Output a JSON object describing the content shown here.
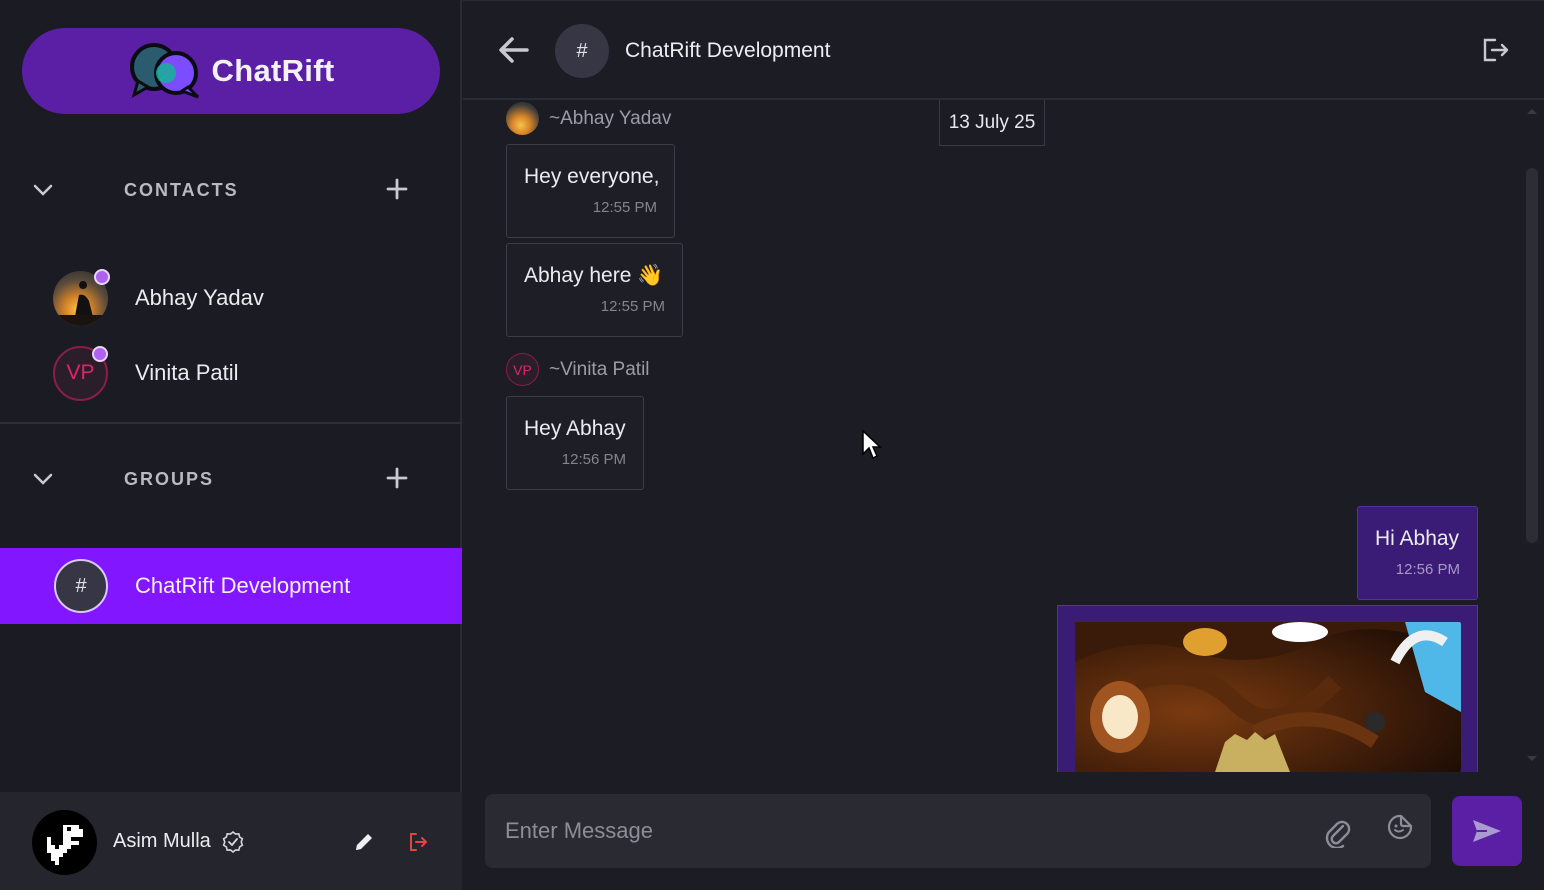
{
  "app": {
    "name": "ChatRift"
  },
  "sidebar": {
    "contacts_title": "CONTACTS",
    "groups_title": "GROUPS",
    "contacts": [
      {
        "name": "Abhay Yadav",
        "initials": "",
        "online": true
      },
      {
        "name": "Vinita Patil",
        "initials": "VP",
        "online": true
      }
    ],
    "groups": [
      {
        "name": "ChatRift Development",
        "icon": "#",
        "active": true
      }
    ],
    "user": {
      "name": "Asim Mulla",
      "verified": true
    }
  },
  "channel": {
    "name": "ChatRift Development",
    "icon": "#"
  },
  "messages": {
    "date_chip": "13 July 25",
    "groups": [
      {
        "sender": "~Abhay Yadav"
      },
      {
        "sender": "~Vinita Patil",
        "initials": "VP"
      }
    ],
    "items": [
      {
        "text": "Hey everyone,",
        "time": "12:55 PM",
        "mine": false
      },
      {
        "text": "Abhay here 👋",
        "time": "12:55 PM",
        "mine": false
      },
      {
        "text": "Hey Abhay",
        "time": "12:56 PM",
        "mine": false
      },
      {
        "text": "Hi Abhay",
        "time": "12:56 PM",
        "mine": true
      }
    ]
  },
  "composer": {
    "placeholder": "Enter Message"
  },
  "colors": {
    "accent": "#8216ff",
    "brand": "#5b1fa6",
    "online": "#b061f0",
    "danger": "#e0453f"
  },
  "icons": [
    "chevron-down-icon",
    "plus-icon",
    "back-arrow-icon",
    "leave-icon",
    "attach-icon",
    "emoji-icon",
    "send-icon",
    "edit-icon",
    "logout-icon",
    "verified-icon"
  ]
}
